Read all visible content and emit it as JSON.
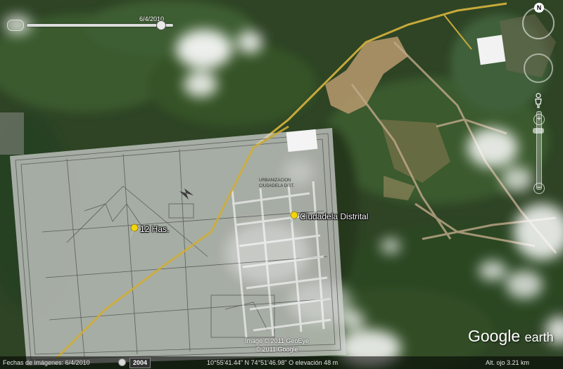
{
  "time_slider": {
    "date_label": "6/4/2010",
    "position": 0.94
  },
  "placemarks": [
    {
      "label": "12 Has."
    },
    {
      "label": "Ciudadela Distrital"
    }
  ],
  "navigation": {
    "north_label": "N",
    "zoom_in": "+",
    "zoom_out": "−"
  },
  "overlay_texts": {
    "urban_label_1": "URBANIZACION",
    "urban_label_2": "CIUDADELA DIST."
  },
  "copyright": {
    "line1": "Image © 2011 GeoEye",
    "line2": "© 2011 Google"
  },
  "logo": {
    "word1": "Google",
    "word2": "earth"
  },
  "status_bar": {
    "imagery_dates": "Fechas de imágenes: 6/4/2010",
    "year_button": "2004",
    "coordinates": "10°55'41.44\" N  74°51'46.98\" O elevación   48 m",
    "eye_alt": "Alt. ojo   3.21 km"
  },
  "colors": {
    "vegetation": "#2f4a26",
    "road": "#c7a93a",
    "clearing": "#b89a6e",
    "overlay_plan": "#d5d5d5"
  },
  "icons": [
    "pushpin-icon",
    "clock-icon",
    "compass-icon",
    "pegman-icon"
  ]
}
